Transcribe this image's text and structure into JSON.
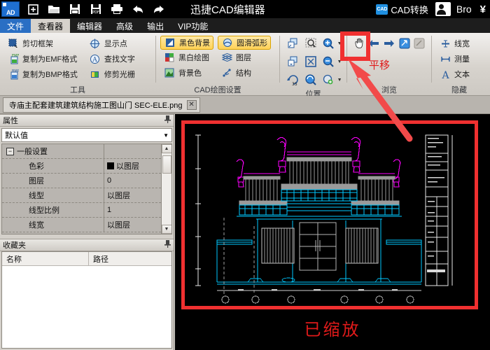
{
  "titlebar": {
    "logo": "AD",
    "app_title": "迅捷CAD编辑器",
    "quick_actions": [
      {
        "name": "new-file-icon",
        "label": "新建"
      },
      {
        "name": "open-folder-icon",
        "label": "打开"
      },
      {
        "name": "save-icon",
        "label": "保存"
      },
      {
        "name": "save-pdf-icon",
        "label": "另存为PDF"
      },
      {
        "name": "print-icon",
        "label": "打印"
      },
      {
        "name": "undo-icon",
        "label": "撤销"
      },
      {
        "name": "redo-icon",
        "label": "重做"
      }
    ],
    "cad_convert": "CAD转换",
    "user_label": "Bro",
    "currency": "¥"
  },
  "tabs": [
    {
      "label": "文件",
      "state": "file"
    },
    {
      "label": "查看器",
      "state": "active"
    },
    {
      "label": "编辑器",
      "state": "normal"
    },
    {
      "label": "高级",
      "state": "normal"
    },
    {
      "label": "输出",
      "state": "normal"
    },
    {
      "label": "VIP功能",
      "state": "normal"
    }
  ],
  "ribbon": {
    "groups": [
      {
        "label": "工具",
        "col1": [
          {
            "label": "剪切框架",
            "icon": "cut-frame-icon"
          },
          {
            "label": "复制为EMF格式",
            "icon": "copy-emf-icon"
          },
          {
            "label": "复制为BMP格式",
            "icon": "copy-bmp-icon"
          }
        ],
        "col2": [
          {
            "label": "显示点",
            "icon": "show-points-icon"
          },
          {
            "label": "查找文字",
            "icon": "find-text-icon"
          },
          {
            "label": "修剪光栅",
            "icon": "trim-raster-icon"
          }
        ]
      },
      {
        "label": "CAD绘图设置",
        "col1": [
          {
            "label": "黑色背景",
            "icon": "black-background-icon",
            "selected": true
          },
          {
            "label": "黑白绘图",
            "icon": "bw-drawing-icon"
          },
          {
            "label": "背景色",
            "icon": "background-color-icon"
          }
        ],
        "col2": [
          {
            "label": "圆滑弧形",
            "icon": "smooth-arc-icon",
            "selected": true
          },
          {
            "label": "图层",
            "icon": "layers-icon"
          },
          {
            "label": "结构",
            "icon": "structure-icon"
          }
        ]
      },
      {
        "label": "位置",
        "icons": [
          "zoom-window-icon",
          "zoom-select-icon",
          "zoom-in-icon",
          "zoom-previous-icon",
          "zoom-extents-icon",
          "zoom-out-icon",
          "rotate-35-icon",
          "zoom-realtime-icon",
          "zoom-object-icon"
        ]
      },
      {
        "label": "浏览",
        "icons": [
          "pan-hand-icon",
          "back-arrow-icon",
          "forward-arrow-icon",
          "export-view-icon",
          "copy-view-icon"
        ]
      },
      {
        "label": "隐藏",
        "col1": [
          {
            "label": "线宽",
            "icon": "line-width-icon"
          },
          {
            "label": "测量",
            "icon": "measure-icon"
          },
          {
            "label": "文本",
            "icon": "text-icon"
          }
        ]
      }
    ]
  },
  "document_tab": {
    "filename": "寺庙主配套建筑建筑结构施工图山门 SEC-ELE.png",
    "close": "✕"
  },
  "properties_panel": {
    "title": "属性",
    "pin": "📌",
    "selector_value": "默认值",
    "group_label": "一般设置",
    "rows": [
      {
        "name": "色彩",
        "value": "以图层",
        "swatch": "#000000"
      },
      {
        "name": "图层",
        "value": "0"
      },
      {
        "name": "线型",
        "value": "以图层"
      },
      {
        "name": "线型比例",
        "value": "1"
      },
      {
        "name": "线宽",
        "value": "以图层"
      }
    ]
  },
  "favorites_panel": {
    "title": "收藏夹",
    "pin": "📌",
    "columns": [
      "名称",
      "路径"
    ],
    "rows": []
  },
  "canvas": {
    "background": "#000000",
    "highlight_color": "#f03030",
    "annotation_bottom": "已缩放",
    "annotation_toolbar": "平移",
    "drawing_colors": {
      "magenta": "#ff00ff",
      "cyan": "#00c8ff",
      "gray": "#9a9a9a",
      "white": "#ffffff"
    }
  }
}
